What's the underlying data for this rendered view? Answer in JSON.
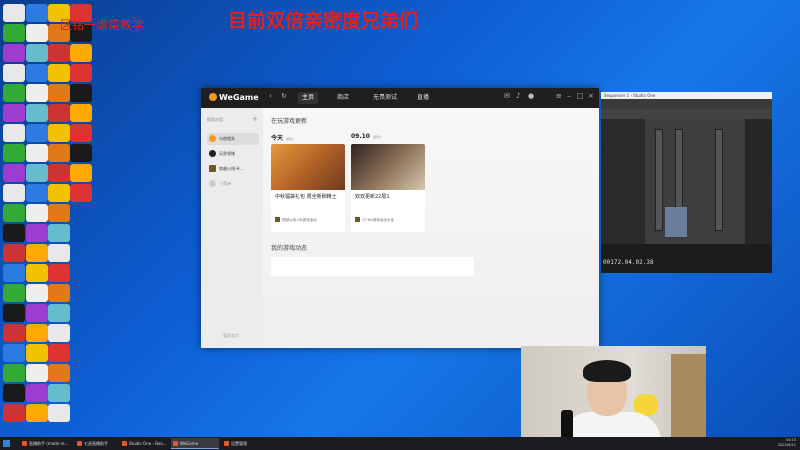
{
  "overlay": {
    "title": "目前双倍亲密度兄弟们",
    "brand": "区铭一虐菜教学"
  },
  "colors": {
    "accent": "#f39a1e",
    "overlay_text": "#e0211d",
    "desktop": "#0e5fd6"
  },
  "wegame": {
    "logo": "WeGame",
    "nav": [
      "主页",
      "商店",
      "无畏测试",
      "直播"
    ],
    "sidebar": {
      "search_placeholder": "搜索应用",
      "items": [
        "与他相关",
        "无畏领域",
        "穿越火线-H...",
        "三角洲"
      ],
      "footer": "管理游戏"
    },
    "main": {
      "section1": "在玩游戏更新",
      "groups": [
        {
          "day": "今天",
          "tag": "游戏2",
          "card_title": "中秋福袋礼包 限全新刷精士",
          "card_game": "穿越火线-HD游戏活动"
        },
        {
          "day": "09.10",
          "tag": "游戏3",
          "card_title": "双双更新22局1",
          "card_game": "CF·HD游戏活动大全"
        }
      ],
      "section2": "我的游戏动态"
    }
  },
  "daw": {
    "title": "Sequencer 1 - Studio One",
    "time": "00172.04.02.38"
  },
  "taskbar": {
    "items": [
      "直播助手 (mode re...",
      "七虎直播助手",
      "Studio One - Boo...",
      "WeGame",
      "设置管理"
    ],
    "clock": "14:15",
    "date": "2022/9/11"
  }
}
